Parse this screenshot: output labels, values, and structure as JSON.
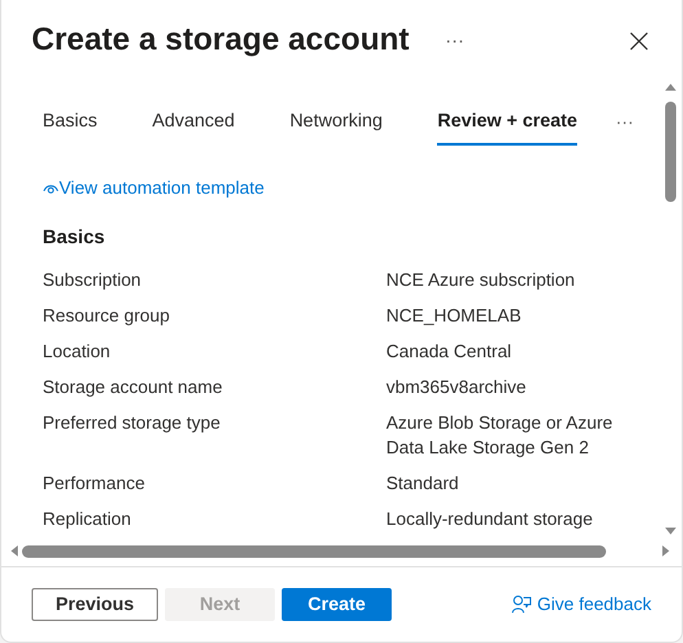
{
  "title": "Create a storage account",
  "more_menu": "···",
  "tabs": [
    {
      "label": "Basics",
      "selected": false
    },
    {
      "label": "Advanced",
      "selected": false
    },
    {
      "label": "Networking",
      "selected": false
    },
    {
      "label": "Review + create",
      "selected": true
    }
  ],
  "tabs_more": "···",
  "automation_link": "View automation template",
  "section_title": "Basics",
  "rows": [
    {
      "label": "Subscription",
      "value": "NCE Azure subscription"
    },
    {
      "label": "Resource group",
      "value": "NCE_HOMELAB"
    },
    {
      "label": "Location",
      "value": "Canada Central"
    },
    {
      "label": "Storage account name",
      "value": "vbm365v8archive"
    },
    {
      "label": "Preferred storage type",
      "value": "Azure Blob Storage or Azure Data Lake Storage Gen 2"
    },
    {
      "label": "Performance",
      "value": "Standard"
    },
    {
      "label": "Replication",
      "value": "Locally-redundant storage"
    }
  ],
  "buttons": [
    {
      "label": "Previous",
      "kind": "secondary",
      "disabled": false
    },
    {
      "label": "Next",
      "kind": "secondary",
      "disabled": true
    },
    {
      "label": "Create",
      "kind": "primary",
      "disabled": false
    }
  ],
  "feedback_link": "Give feedback"
}
